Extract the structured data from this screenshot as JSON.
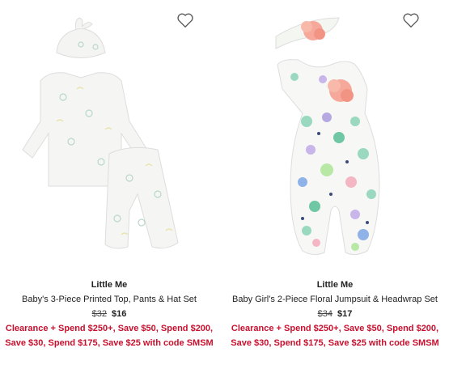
{
  "products": [
    {
      "brand": "Little Me",
      "name": "Baby's 3-Piece Printed Top, Pants & Hat Set",
      "price_original": "$32",
      "price_sale": "$16",
      "promo": "Clearance + Spend $250+, Save $50, Spend $200, Save $30, Spend $175, Save $25 with code SMSM"
    },
    {
      "brand": "Little Me",
      "name": "Baby Girl's 2-Piece Floral Jumpsuit & Headwrap Set",
      "price_original": "$34",
      "price_sale": "$17",
      "promo": "Clearance + Spend $250+, Save $50, Spend $200, Save $30, Spend $175, Save $25 with code SMSM"
    }
  ],
  "colors": {
    "promo": "#c8102e",
    "heart": "#444444"
  }
}
